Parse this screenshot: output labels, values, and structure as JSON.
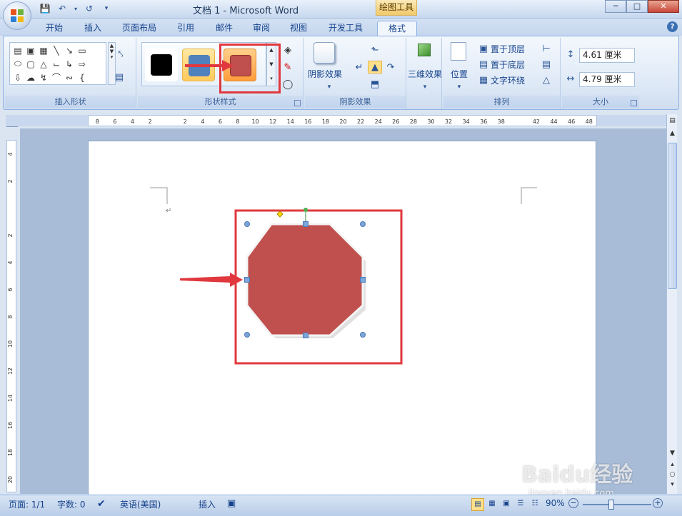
{
  "window": {
    "title": "文档 1 - Microsoft Word",
    "context_tab": "绘图工具"
  },
  "tabs": [
    "开始",
    "插入",
    "页面布局",
    "引用",
    "邮件",
    "审阅",
    "视图",
    "开发工具",
    "格式"
  ],
  "groups": {
    "insert_shapes": "插入形状",
    "shape_styles": "形状样式",
    "shadow_effects": "阴影效果",
    "arrange": "排列",
    "size": "大小"
  },
  "buttons": {
    "shadow_effect": "阴影效果",
    "three_d_effect": "三维效果",
    "position": "位置",
    "bring_to_front": "置于顶层",
    "send_to_back": "置于底层",
    "text_wrap": "文字环绕"
  },
  "size": {
    "height": "4.61 厘米",
    "width": "4.79 厘米"
  },
  "ruler_h_labels": [
    "8",
    "6",
    "4",
    "2",
    "",
    "2",
    "4",
    "6",
    "8",
    "10",
    "12",
    "14",
    "16",
    "18",
    "20",
    "22",
    "24",
    "26",
    "28",
    "30",
    "32",
    "34",
    "36",
    "38",
    "",
    "42",
    "44",
    "46",
    "48"
  ],
  "ruler_v_labels": [
    "4",
    "2",
    "",
    "2",
    "4",
    "6",
    "8",
    "10",
    "12",
    "14",
    "16",
    "18",
    "20"
  ],
  "status": {
    "page": "页面: 1/1",
    "words": "字数: 0",
    "language": "英语(美国)",
    "insert_mode": "插入",
    "zoom": "90%"
  },
  "watermark": {
    "brand": "Baidu经验",
    "url": "jingyan.baidu.com"
  },
  "colors": {
    "shape_fill": "#c0504d",
    "highlight": "#e0383e",
    "swatch_blue": "#4f81bd"
  }
}
